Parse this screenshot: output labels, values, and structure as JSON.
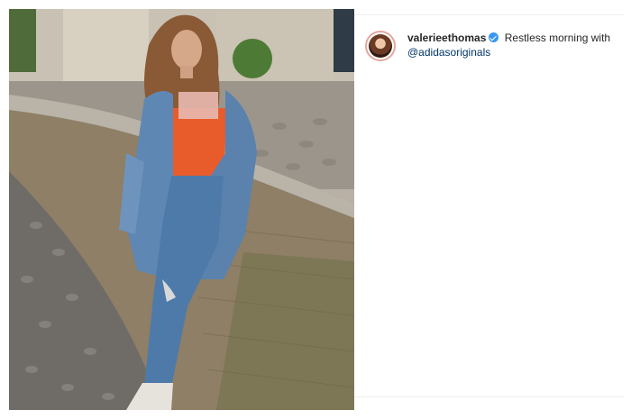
{
  "post": {
    "username": "valerieethomas",
    "caption_text": "Restless morning with",
    "mention": "@adidasoriginals",
    "verified_color": "#3897f0"
  },
  "photo": {
    "description_icon": "post-photo"
  }
}
